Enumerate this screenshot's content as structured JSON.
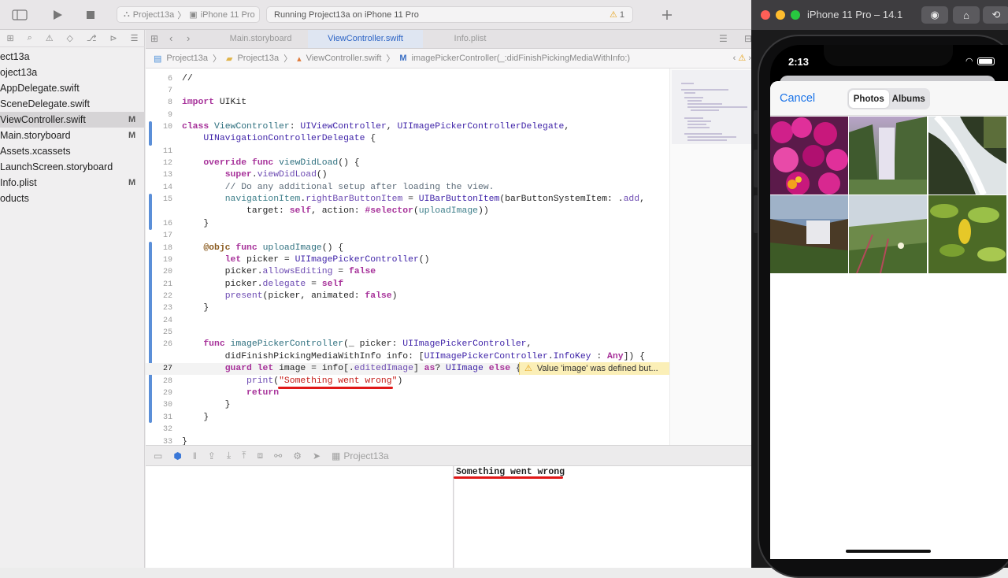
{
  "toolbar": {
    "scheme": "Project13a",
    "device": "iPhone 11 Pro",
    "activity": "Running Project13a on iPhone 11 Pro",
    "warning_count": "1"
  },
  "navigator": {
    "items": [
      {
        "label": "ect13a",
        "mark": ""
      },
      {
        "label": "oject13a",
        "mark": ""
      },
      {
        "label": "AppDelegate.swift",
        "mark": ""
      },
      {
        "label": "SceneDelegate.swift",
        "mark": ""
      },
      {
        "label": "ViewController.swift",
        "mark": "M"
      },
      {
        "label": "Main.storyboard",
        "mark": "M"
      },
      {
        "label": "Assets.xcassets",
        "mark": ""
      },
      {
        "label": "LaunchScreen.storyboard",
        "mark": ""
      },
      {
        "label": "Info.plist",
        "mark": "M"
      },
      {
        "label": "oducts",
        "mark": ""
      }
    ]
  },
  "tabs": [
    "Main.storyboard",
    "ViewController.swift",
    "Info.plist"
  ],
  "breadcrumb": [
    "Project13a",
    "Project13a",
    "ViewController.swift",
    "imagePickerController(_:didFinishPickingMediaWithInfo:)"
  ],
  "code": {
    "line_numbers": [
      "6",
      "7",
      "8",
      "9",
      "10",
      "",
      "11",
      "12",
      "13",
      "14",
      "15",
      "",
      "16",
      "17",
      "18",
      "19",
      "20",
      "21",
      "22",
      "23",
      "24",
      "25",
      "26",
      "",
      "27",
      "28",
      "29",
      "30",
      "31",
      "32",
      "33"
    ],
    "comment_setup": "// Do any additional setup after loading the view.",
    "string_literal": "\"Something went wrong\"",
    "warning": "Value 'image' was defined but..."
  },
  "debug": {
    "target": "Project13a",
    "console_output": "Something went wrong"
  },
  "simulator": {
    "title": "iPhone 11 Pro – 14.1",
    "time": "2:13",
    "cancel": "Cancel",
    "segments": [
      "Photos",
      "Albums"
    ]
  },
  "colors": {
    "accent": "#2c64c5",
    "keyword": "#a7329a",
    "string": "#c41a16",
    "warning_bg": "#fbefb7",
    "annotation_red": "#e01818",
    "ios_blue": "#1a73e8"
  }
}
